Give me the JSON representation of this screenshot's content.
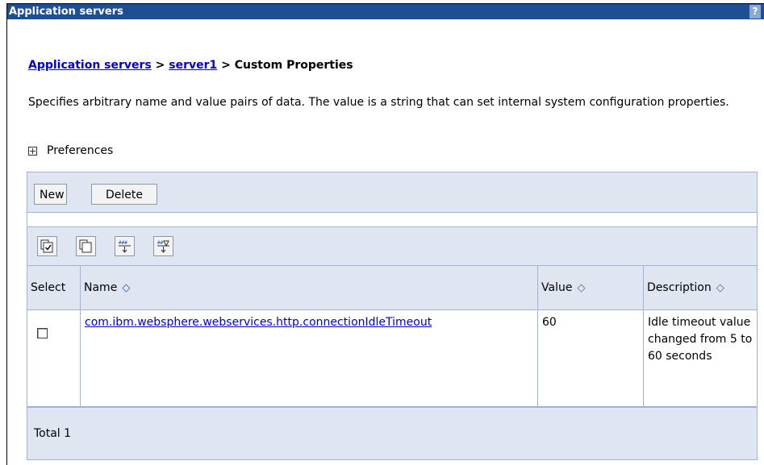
{
  "window": {
    "title": "Application servers",
    "help_icon": "?"
  },
  "breadcrumb": {
    "link1": "Application servers",
    "sep1": " > ",
    "link2": "server1",
    "sep2": " > ",
    "current": "Custom Properties"
  },
  "description": "Specifies arbitrary name and value pairs of data. The value is a string that can set internal system configuration properties.",
  "preferences": {
    "label": "Preferences",
    "icon": "plus-box-icon"
  },
  "toolbar": {
    "new_label": "New",
    "delete_label": "Delete"
  },
  "icons": {
    "select_all": "select-all-icon",
    "deselect_all": "deselect-all-icon",
    "show_filter": "show-filter-icon",
    "clear_filter": "clear-filter-icon"
  },
  "table": {
    "headers": {
      "select": "Select",
      "name": "Name",
      "value": "Value",
      "description": "Description"
    },
    "sort_symbol": "◇",
    "rows": [
      {
        "name": "com.ibm.websphere.webservices.http.connectionIdleTimeout",
        "value": "60",
        "description": "Idle timeout value changed from 5 to 60 seconds"
      }
    ],
    "total": "Total 1"
  },
  "colors": {
    "title_bar": "#1e4f93",
    "panel_bg": "#dfe6f1",
    "link": "#0000cc"
  }
}
